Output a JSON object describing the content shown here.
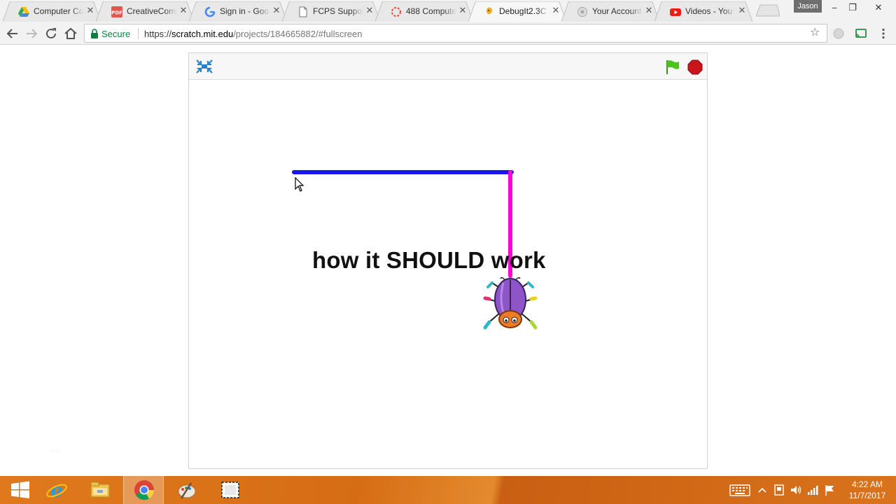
{
  "browser": {
    "tabs": [
      {
        "title": "Computer Co",
        "icon": "google-drive-icon",
        "active": false
      },
      {
        "title": "CreativeComp",
        "icon": "pdf-icon",
        "active": false
      },
      {
        "title": "Sign in - Goo",
        "icon": "google-icon",
        "active": false
      },
      {
        "title": "FCPS Support",
        "icon": "document-icon",
        "active": false
      },
      {
        "title": "488 Compute",
        "icon": "loading-icon",
        "active": false
      },
      {
        "title": "DebugIt2.3C",
        "icon": "scratch-icon",
        "active": true
      },
      {
        "title": "Your Account",
        "icon": "account-icon",
        "active": false
      },
      {
        "title": "Videos - You",
        "icon": "youtube-icon",
        "active": false
      }
    ],
    "profile_name": "Jason",
    "window_controls": {
      "minimize": "–",
      "restore": "❐",
      "close": "✕"
    },
    "omnibox": {
      "secure_label": "Secure",
      "url_scheme": "https://",
      "url_host": "scratch.mit.edu",
      "url_path": "/projects/184665882/#fullscreen"
    }
  },
  "player": {
    "stage_text": "how it SHOULD work"
  },
  "taskbar": {
    "apps": [
      "windows-start-icon",
      "internet-explorer-icon",
      "file-explorer-icon",
      "chrome-icon",
      "paint-icon",
      "snipping-tool-icon"
    ],
    "clock_time": "4:22 AM",
    "clock_date": "11/7/2017"
  },
  "colors": {
    "taskbar": "#d9731c",
    "pen_blue": "#1616f0",
    "pen_magenta": "#ff00d6",
    "flag_green": "#4cc21c",
    "stop_red": "#c8141a"
  }
}
